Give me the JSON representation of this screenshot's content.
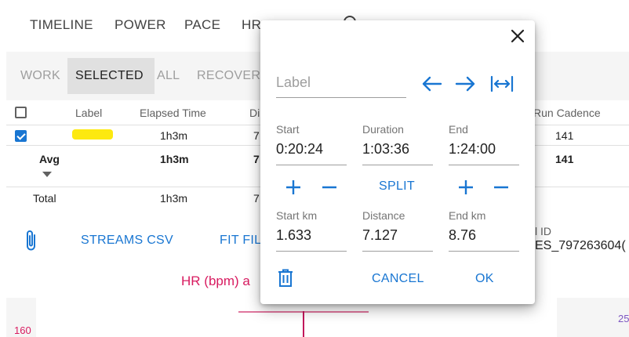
{
  "tabs": [
    "TIMELINE",
    "POWER",
    "PACE",
    "HR"
  ],
  "subtabs": [
    "WORK",
    "SELECTED",
    "ALL",
    "RECOVERY"
  ],
  "table": {
    "headers": [
      "Label",
      "Elapsed Time",
      "Di",
      "Run Cadence"
    ],
    "row1": {
      "elapsed": "1h3m",
      "di": "7",
      "cadence": "141"
    },
    "avg": {
      "label": "Avg",
      "elapsed": "1h3m",
      "di": "7",
      "cadence": "141"
    },
    "total": {
      "label": "Total",
      "elapsed": "1h3m",
      "di": "7"
    }
  },
  "actions": {
    "streams_csv": "STREAMS CSV",
    "fit_file": "FIT FIL",
    "id_label": "l ID",
    "id_value": "ES_797263604("
  },
  "chart": {
    "title": "HR (bpm) a",
    "y_left": "160",
    "y_right": "25"
  },
  "modal": {
    "label_placeholder": "Label",
    "start_label": "Start",
    "start_value": "0:20:24",
    "duration_label": "Duration",
    "duration_value": "1:03:36",
    "end_label": "End",
    "end_value": "1:24:00",
    "split": "SPLIT",
    "startkm_label": "Start km",
    "startkm_value": "1.633",
    "distance_label": "Distance",
    "distance_value": "7.127",
    "endkm_label": "End km",
    "endkm_value": "8.76",
    "cancel": "CANCEL",
    "ok": "OK"
  },
  "colors": {
    "accent": "#1976d2",
    "chart_title": "#d81b60",
    "highlight": "#fde910"
  }
}
